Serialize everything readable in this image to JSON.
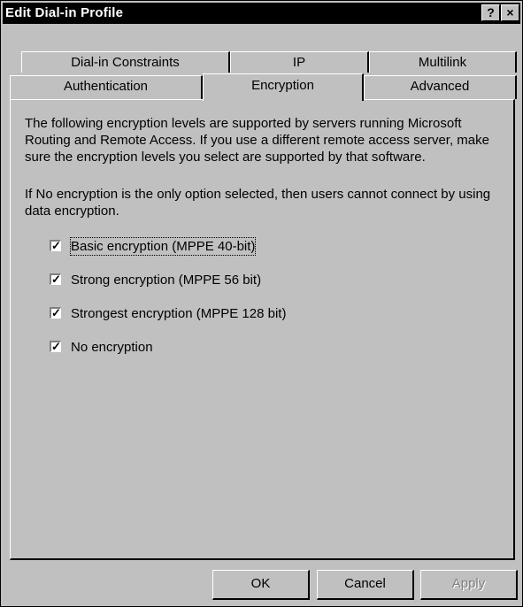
{
  "window": {
    "title": "Edit Dial-in Profile",
    "help_glyph": "?",
    "close_glyph": "×"
  },
  "tabs": {
    "row_back": [
      {
        "label": "Dial-in Constraints"
      },
      {
        "label": "IP"
      },
      {
        "label": "Multilink"
      }
    ],
    "row_front": [
      {
        "label": "Authentication"
      },
      {
        "label": "Encryption",
        "selected": true
      },
      {
        "label": "Advanced"
      }
    ]
  },
  "panel": {
    "intro_text": "The following encryption levels are supported by servers running Microsoft Routing and Remote Access. If you use a different remote access server, make sure the encryption levels you select are supported by that software.",
    "note_text": "If No encryption is the only option selected, then users cannot connect by using data encryption.",
    "options": [
      {
        "label": "Basic encryption (MPPE 40-bit)",
        "checked": true
      },
      {
        "label": "Strong encryption (MPPE 56 bit)",
        "checked": true
      },
      {
        "label": "Strongest encryption (MPPE 128 bit)",
        "checked": true
      },
      {
        "label": "No encryption",
        "checked": true
      }
    ],
    "check_glyph": "✓"
  },
  "buttons": {
    "ok": "OK",
    "cancel": "Cancel",
    "apply": "Apply"
  }
}
